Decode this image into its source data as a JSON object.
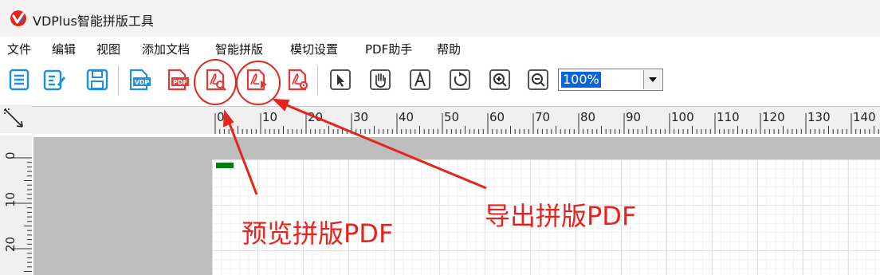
{
  "window": {
    "title": "VDPlus智能拼版工具"
  },
  "menu": [
    "文件",
    "编辑",
    "视图",
    "添加文档",
    "智能拼版",
    "模切设置",
    "PDF助手",
    "帮助"
  ],
  "toolbar": {
    "zoom_value": "100%",
    "buttons": [
      "list-icon",
      "edit-icon",
      "save-icon",
      "vdp-icon",
      "pdf-icon",
      "preview-pdf-icon",
      "export-pdf-icon",
      "pdf-settings-icon",
      "select-icon",
      "hand-icon",
      "text-icon",
      "rotate-icon",
      "zoom-in-icon",
      "zoom-out-icon"
    ]
  },
  "ruler": {
    "h_labels": [
      "0",
      "10",
      "20",
      "30",
      "40",
      "50",
      "60",
      "70",
      "80",
      "90",
      "100",
      "110",
      "120",
      "130",
      "140"
    ],
    "v_labels": [
      "0",
      "10",
      "20"
    ]
  },
  "annotations": {
    "preview_label": "预览拼版PDF",
    "export_label": "导出拼版PDF"
  },
  "colors": {
    "annotation": "#e8231d",
    "accent_blue": "#1f8fe0",
    "pdf_red": "#e53935"
  }
}
